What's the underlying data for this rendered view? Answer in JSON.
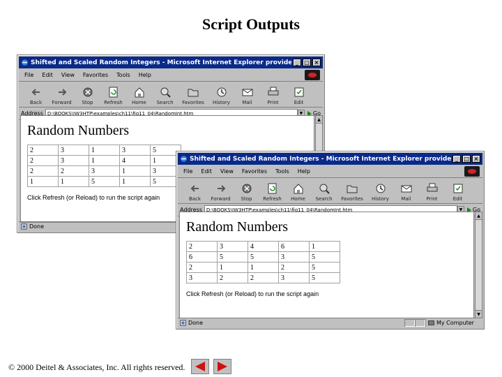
{
  "slide": {
    "title": "Script Outputs",
    "footer": "© 2000 Deitel & Associates, Inc.  All rights reserved."
  },
  "browser": {
    "menu": [
      "File",
      "Edit",
      "View",
      "Favorites",
      "Tools",
      "Help"
    ],
    "toolbar": {
      "back": "Back",
      "forward": "Forward",
      "stop": "Stop",
      "refresh": "Refresh",
      "home": "Home",
      "search": "Search",
      "favorites": "Favorites",
      "history": "History",
      "mail": "Mail",
      "print": "Print",
      "edit": "Edit"
    },
    "address_label": "Address",
    "go_label": "Go",
    "page_heading": "Random Numbers",
    "hint_text": "Click Refresh (or Reload) to run the script again"
  },
  "window1": {
    "title": "Shifted and Scaled Random Integers - Microsoft Internet Explorer provided by MSN",
    "address": "D:\\BOOKS\\IW3HTP\\examples\\ch11\\fig11_04\\RandomInt.htm",
    "rows": [
      [
        "2",
        "3",
        "1",
        "3",
        "5"
      ],
      [
        "2",
        "3",
        "1",
        "4",
        "1"
      ],
      [
        "2",
        "2",
        "3",
        "1",
        "3"
      ],
      [
        "1",
        "1",
        "5",
        "1",
        "5"
      ]
    ],
    "status": "Done"
  },
  "window2": {
    "title": "Shifted and Scaled Random Integers - Microsoft Internet Explorer provided by MSN",
    "address": "D:\\BOOKS\\IW3HTP\\examples\\ch11\\fig11_04\\RandomInt.htm",
    "rows": [
      [
        "2",
        "3",
        "4",
        "6",
        "1"
      ],
      [
        "6",
        "5",
        "5",
        "3",
        "5"
      ],
      [
        "2",
        "1",
        "1",
        "2",
        "5"
      ],
      [
        "3",
        "2",
        "2",
        "3",
        "5"
      ]
    ],
    "status": "Done",
    "zone": "My Computer"
  },
  "colors": {
    "titlebar": "#0a2a8a",
    "chrome": "#c0c0c0",
    "nav_arrow": "#d01010"
  }
}
